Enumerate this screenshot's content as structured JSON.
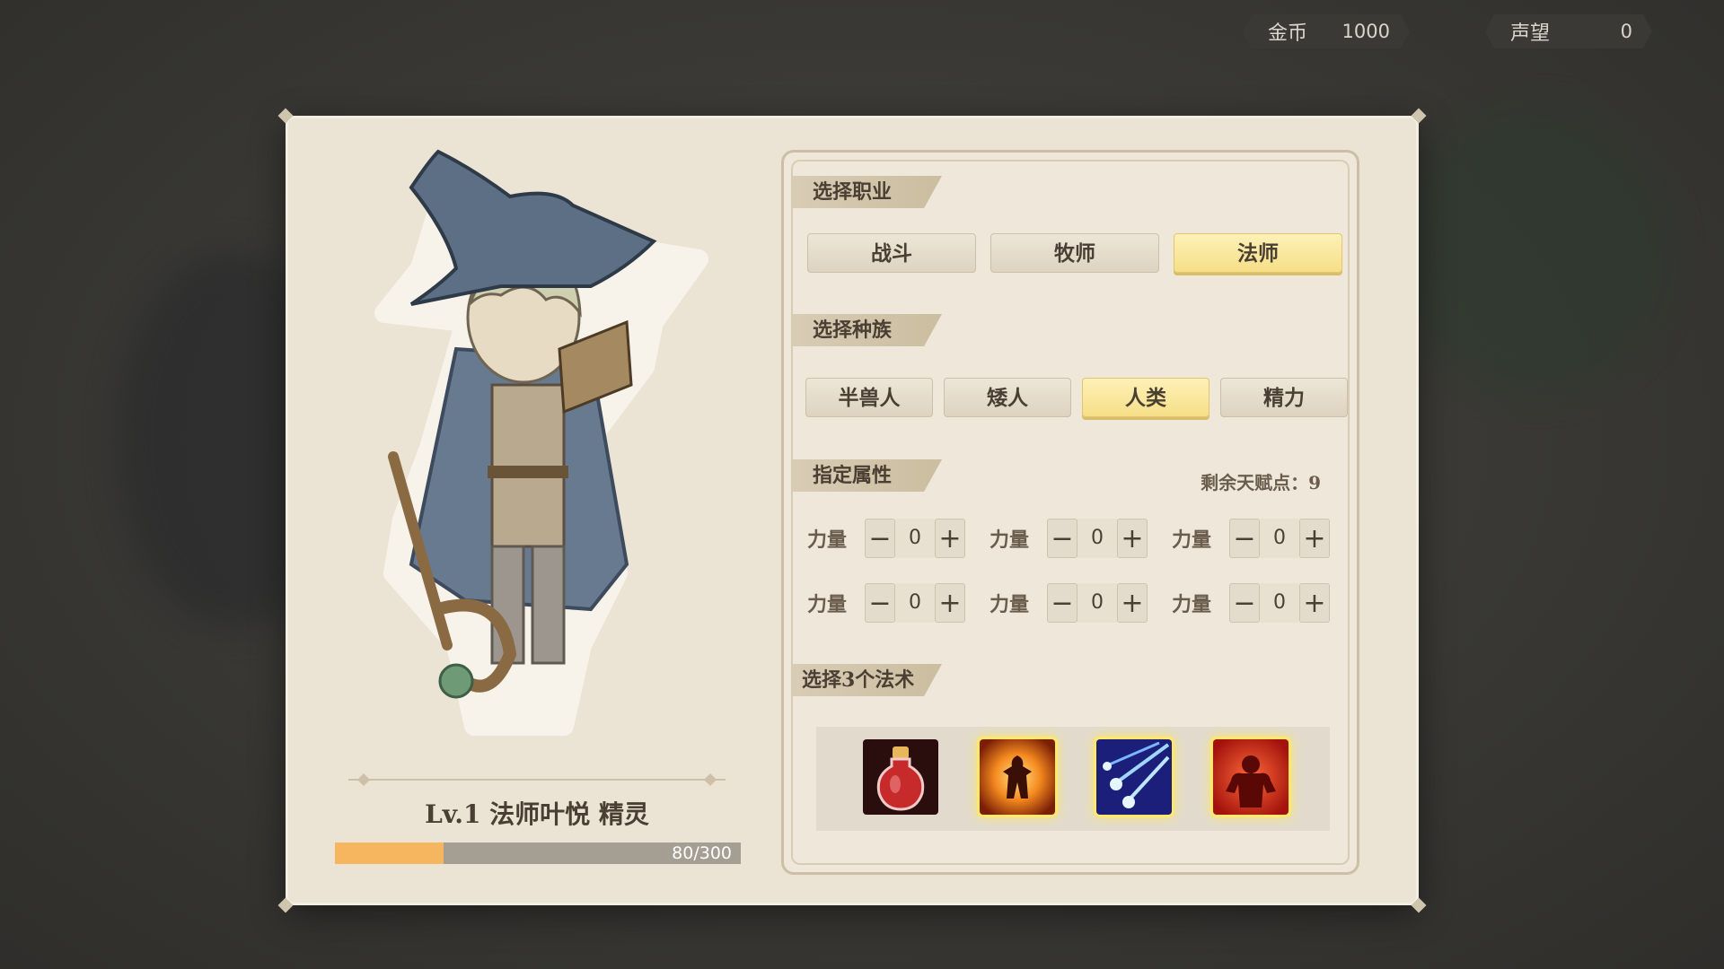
{
  "currency": {
    "gold_label": "金币",
    "gold_value": "1000",
    "fame_label": "声望",
    "fame_value": "0"
  },
  "character": {
    "name": "Lv.1 法师叶悦 精灵",
    "xp_text": "80/300",
    "xp_fraction": 0.267
  },
  "class_section": {
    "title": "选择职业",
    "options": [
      "战斗",
      "牧师",
      "法师"
    ],
    "selected": "法师"
  },
  "race_section": {
    "title": "选择种族",
    "options": [
      "半兽人",
      "矮人",
      "人类",
      "精力"
    ],
    "selected": "人类"
  },
  "attr_section": {
    "title": "指定属性",
    "talent_points": "剩余天赋点：9",
    "attributes": [
      {
        "label": "力量",
        "value": "0"
      },
      {
        "label": "力量",
        "value": "0"
      },
      {
        "label": "力量",
        "value": "0"
      },
      {
        "label": "力量",
        "value": "0"
      },
      {
        "label": "力量",
        "value": "0"
      },
      {
        "label": "力量",
        "value": "0"
      }
    ],
    "minus": "−",
    "plus": "+"
  },
  "spell_section": {
    "title": "选择3个法术",
    "spells": [
      {
        "icon": "blood-potion-icon",
        "selected": false
      },
      {
        "icon": "fire-aura-icon",
        "selected": true
      },
      {
        "icon": "magic-missile-icon",
        "selected": true
      },
      {
        "icon": "rage-icon",
        "selected": true
      }
    ]
  },
  "colors": {
    "selected_button": "#f6df88",
    "xp_fill": "#f6b660",
    "panel": "#ebe3d3"
  }
}
